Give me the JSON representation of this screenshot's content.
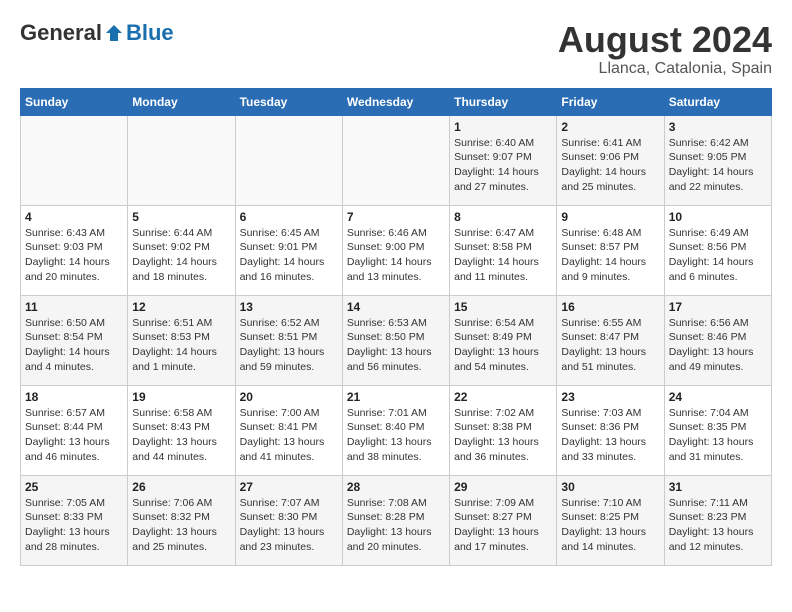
{
  "header": {
    "logo_general": "General",
    "logo_blue": "Blue",
    "month_year": "August 2024",
    "location": "Llanca, Catalonia, Spain"
  },
  "weekdays": [
    "Sunday",
    "Monday",
    "Tuesday",
    "Wednesday",
    "Thursday",
    "Friday",
    "Saturday"
  ],
  "weeks": [
    [
      {
        "day": "",
        "info": ""
      },
      {
        "day": "",
        "info": ""
      },
      {
        "day": "",
        "info": ""
      },
      {
        "day": "",
        "info": ""
      },
      {
        "day": "1",
        "info": "Sunrise: 6:40 AM\nSunset: 9:07 PM\nDaylight: 14 hours and 27 minutes."
      },
      {
        "day": "2",
        "info": "Sunrise: 6:41 AM\nSunset: 9:06 PM\nDaylight: 14 hours and 25 minutes."
      },
      {
        "day": "3",
        "info": "Sunrise: 6:42 AM\nSunset: 9:05 PM\nDaylight: 14 hours and 22 minutes."
      }
    ],
    [
      {
        "day": "4",
        "info": "Sunrise: 6:43 AM\nSunset: 9:03 PM\nDaylight: 14 hours and 20 minutes."
      },
      {
        "day": "5",
        "info": "Sunrise: 6:44 AM\nSunset: 9:02 PM\nDaylight: 14 hours and 18 minutes."
      },
      {
        "day": "6",
        "info": "Sunrise: 6:45 AM\nSunset: 9:01 PM\nDaylight: 14 hours and 16 minutes."
      },
      {
        "day": "7",
        "info": "Sunrise: 6:46 AM\nSunset: 9:00 PM\nDaylight: 14 hours and 13 minutes."
      },
      {
        "day": "8",
        "info": "Sunrise: 6:47 AM\nSunset: 8:58 PM\nDaylight: 14 hours and 11 minutes."
      },
      {
        "day": "9",
        "info": "Sunrise: 6:48 AM\nSunset: 8:57 PM\nDaylight: 14 hours and 9 minutes."
      },
      {
        "day": "10",
        "info": "Sunrise: 6:49 AM\nSunset: 8:56 PM\nDaylight: 14 hours and 6 minutes."
      }
    ],
    [
      {
        "day": "11",
        "info": "Sunrise: 6:50 AM\nSunset: 8:54 PM\nDaylight: 14 hours and 4 minutes."
      },
      {
        "day": "12",
        "info": "Sunrise: 6:51 AM\nSunset: 8:53 PM\nDaylight: 14 hours and 1 minute."
      },
      {
        "day": "13",
        "info": "Sunrise: 6:52 AM\nSunset: 8:51 PM\nDaylight: 13 hours and 59 minutes."
      },
      {
        "day": "14",
        "info": "Sunrise: 6:53 AM\nSunset: 8:50 PM\nDaylight: 13 hours and 56 minutes."
      },
      {
        "day": "15",
        "info": "Sunrise: 6:54 AM\nSunset: 8:49 PM\nDaylight: 13 hours and 54 minutes."
      },
      {
        "day": "16",
        "info": "Sunrise: 6:55 AM\nSunset: 8:47 PM\nDaylight: 13 hours and 51 minutes."
      },
      {
        "day": "17",
        "info": "Sunrise: 6:56 AM\nSunset: 8:46 PM\nDaylight: 13 hours and 49 minutes."
      }
    ],
    [
      {
        "day": "18",
        "info": "Sunrise: 6:57 AM\nSunset: 8:44 PM\nDaylight: 13 hours and 46 minutes."
      },
      {
        "day": "19",
        "info": "Sunrise: 6:58 AM\nSunset: 8:43 PM\nDaylight: 13 hours and 44 minutes."
      },
      {
        "day": "20",
        "info": "Sunrise: 7:00 AM\nSunset: 8:41 PM\nDaylight: 13 hours and 41 minutes."
      },
      {
        "day": "21",
        "info": "Sunrise: 7:01 AM\nSunset: 8:40 PM\nDaylight: 13 hours and 38 minutes."
      },
      {
        "day": "22",
        "info": "Sunrise: 7:02 AM\nSunset: 8:38 PM\nDaylight: 13 hours and 36 minutes."
      },
      {
        "day": "23",
        "info": "Sunrise: 7:03 AM\nSunset: 8:36 PM\nDaylight: 13 hours and 33 minutes."
      },
      {
        "day": "24",
        "info": "Sunrise: 7:04 AM\nSunset: 8:35 PM\nDaylight: 13 hours and 31 minutes."
      }
    ],
    [
      {
        "day": "25",
        "info": "Sunrise: 7:05 AM\nSunset: 8:33 PM\nDaylight: 13 hours and 28 minutes."
      },
      {
        "day": "26",
        "info": "Sunrise: 7:06 AM\nSunset: 8:32 PM\nDaylight: 13 hours and 25 minutes."
      },
      {
        "day": "27",
        "info": "Sunrise: 7:07 AM\nSunset: 8:30 PM\nDaylight: 13 hours and 23 minutes."
      },
      {
        "day": "28",
        "info": "Sunrise: 7:08 AM\nSunset: 8:28 PM\nDaylight: 13 hours and 20 minutes."
      },
      {
        "day": "29",
        "info": "Sunrise: 7:09 AM\nSunset: 8:27 PM\nDaylight: 13 hours and 17 minutes."
      },
      {
        "day": "30",
        "info": "Sunrise: 7:10 AM\nSunset: 8:25 PM\nDaylight: 13 hours and 14 minutes."
      },
      {
        "day": "31",
        "info": "Sunrise: 7:11 AM\nSunset: 8:23 PM\nDaylight: 13 hours and 12 minutes."
      }
    ]
  ]
}
